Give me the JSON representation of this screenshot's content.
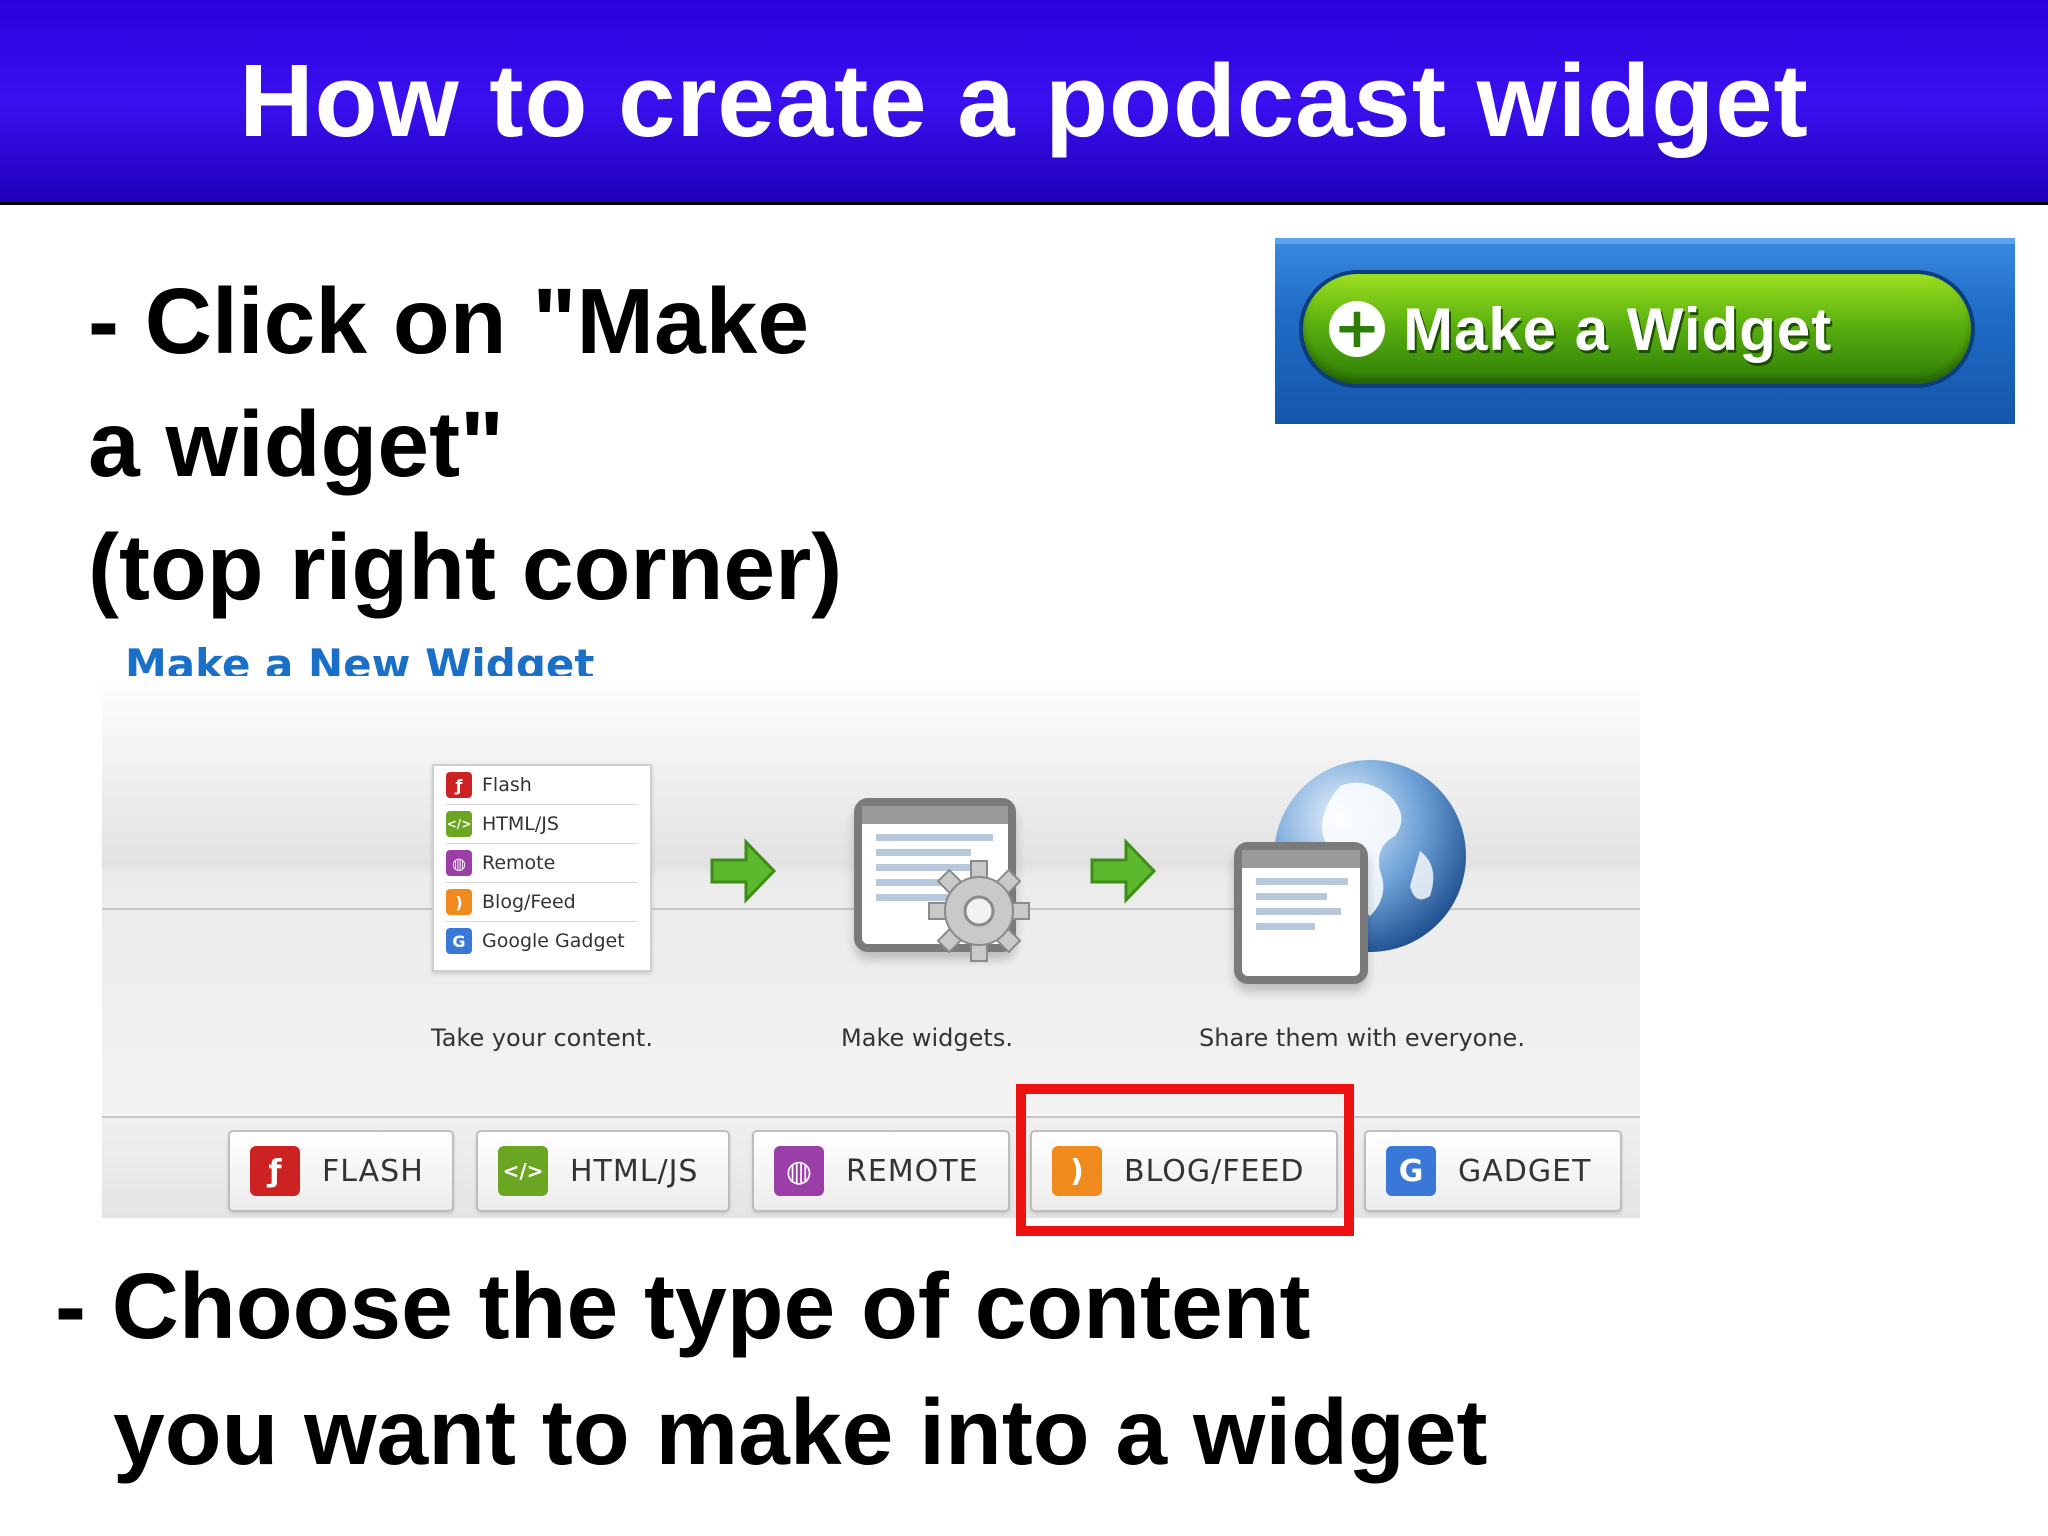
{
  "slide": {
    "title": "How to create a podcast widget",
    "step1": [
      "- Click on \"Make",
      "a widget\"",
      "(top right corner)"
    ],
    "step2": [
      "- Choose the type of content",
      "you want to make into a widget"
    ]
  },
  "make_widget_button": {
    "label": "Make a Widget",
    "icon": "plus-circle-icon",
    "color": "#5cb110"
  },
  "screenshot": {
    "heading": "Make a New Widget",
    "content_menu": [
      {
        "label": "Flash",
        "icon": "flash-icon",
        "color": "#cc2222"
      },
      {
        "label": "HTML/JS",
        "icon": "code-icon",
        "color": "#6aa622"
      },
      {
        "label": "Remote",
        "icon": "globe-icon",
        "color": "#9b3ea8"
      },
      {
        "label": "Blog/Feed",
        "icon": "rss-icon",
        "color": "#f08a1c"
      },
      {
        "label": "Google Gadget",
        "icon": "google-g-icon",
        "color": "#3a78d8"
      }
    ],
    "steps": [
      {
        "caption": "Take your content."
      },
      {
        "caption": "Make widgets."
      },
      {
        "caption": "Share them with everyone."
      }
    ],
    "type_buttons": [
      {
        "label": "FLASH",
        "icon": "flash-icon",
        "color": "#cc2222"
      },
      {
        "label": "HTML/JS",
        "icon": "code-icon",
        "color": "#6aa622"
      },
      {
        "label": "REMOTE",
        "icon": "globe-icon",
        "color": "#9b3ea8"
      },
      {
        "label": "BLOG/FEED",
        "icon": "rss-icon",
        "color": "#f08a1c",
        "highlighted": true
      },
      {
        "label": "GADGET",
        "icon": "google-g-icon",
        "color": "#3a78d8"
      }
    ],
    "highlight_color": "#ee1111"
  }
}
